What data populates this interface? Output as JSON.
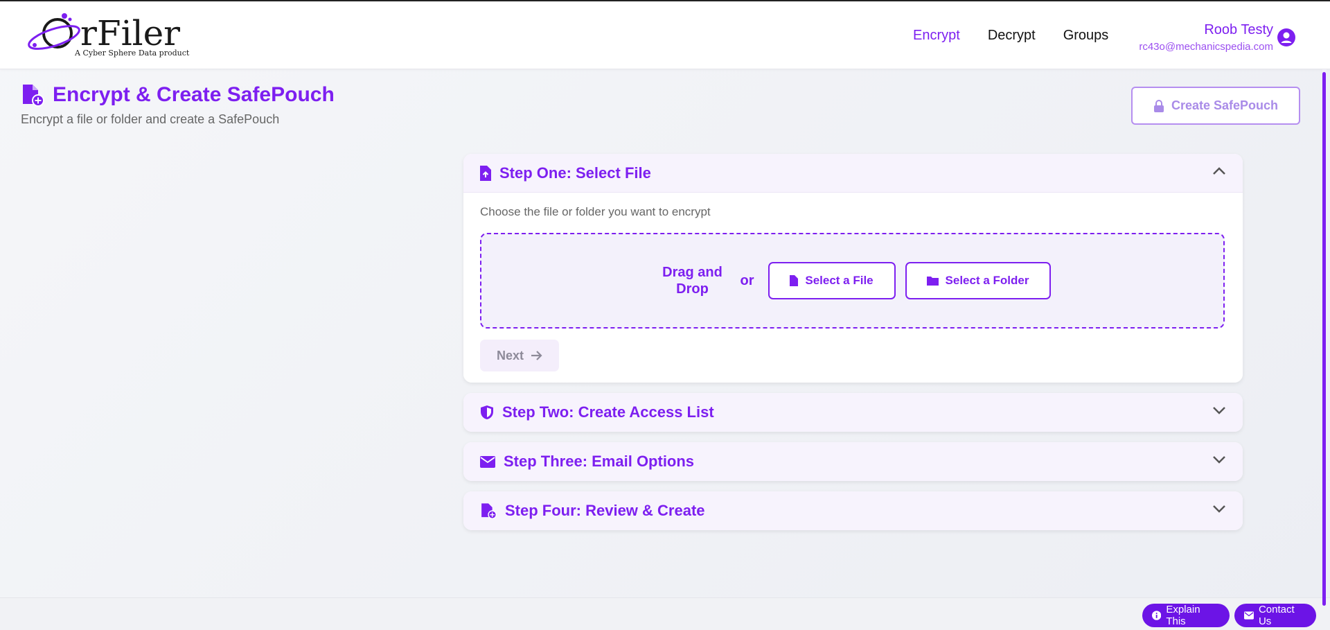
{
  "app": {
    "logo_text": "rFiler",
    "logo_tagline": "A Cyber Sphere Data product"
  },
  "nav": {
    "items": [
      {
        "label": "Encrypt",
        "active": true
      },
      {
        "label": "Decrypt",
        "active": false
      },
      {
        "label": "Groups",
        "active": false
      }
    ]
  },
  "user": {
    "name": "Roob Testy",
    "email": "rc43o@mechanicspedia.com",
    "avatar_icon": "user-circle-icon"
  },
  "page": {
    "title": "Encrypt & Create SafePouch",
    "subtitle": "Encrypt a file or folder and create a SafePouch",
    "create_button": "Create SafePouch",
    "create_disabled": true
  },
  "steps": [
    {
      "label": "Step One: Select File",
      "icon": "file-upload-icon",
      "expanded": true,
      "description": "Choose the file or folder you want to encrypt",
      "drag_text": "Drag and Drop",
      "or_text": "or",
      "select_file": "Select a File",
      "select_folder": "Select a Folder",
      "next_label": "Next"
    },
    {
      "label": "Step Two: Create Access List",
      "icon": "shield-icon",
      "expanded": false
    },
    {
      "label": "Step Three: Email Options",
      "icon": "envelope-icon",
      "expanded": false
    },
    {
      "label": "Step Four: Review & Create",
      "icon": "file-plus-icon",
      "expanded": false
    }
  ],
  "floating": {
    "explain": "Explain This",
    "contact": "Contact Us"
  },
  "colors": {
    "accent": "#7d1ff0",
    "accent_dark": "#6c14e6",
    "disabled": "#a98be8"
  }
}
